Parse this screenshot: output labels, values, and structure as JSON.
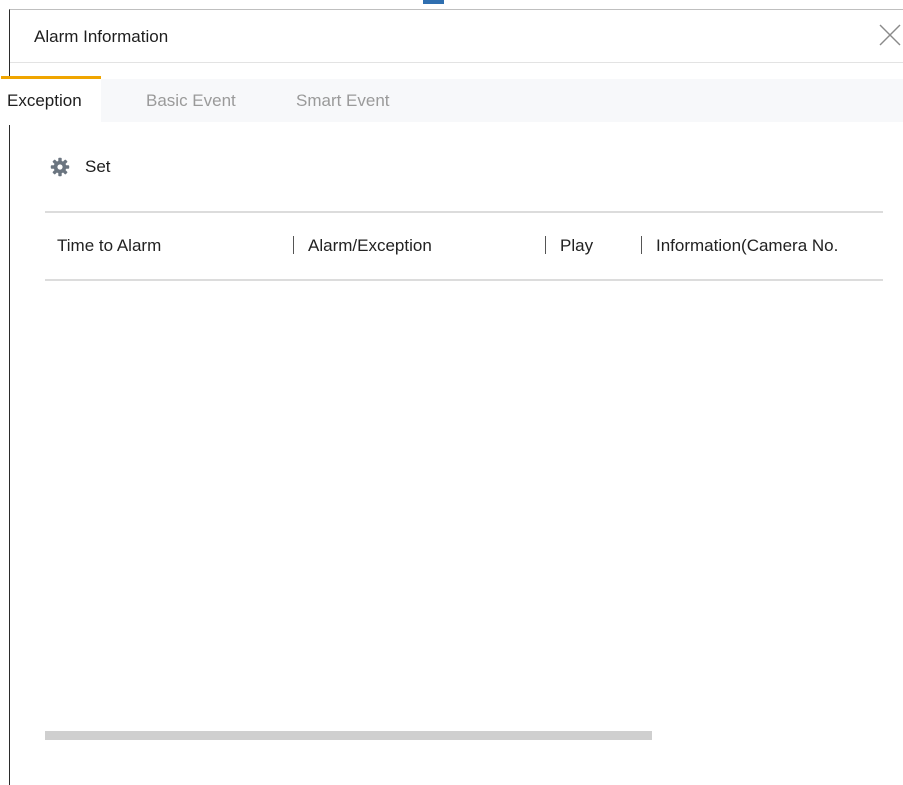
{
  "dialog": {
    "title": "Alarm Information",
    "close_icon": "close-icon"
  },
  "tabs": [
    {
      "label": "Exception",
      "active": true
    },
    {
      "label": "Basic Event",
      "active": false
    },
    {
      "label": "Smart Event",
      "active": false
    }
  ],
  "toolbar": {
    "set_icon": "gear-icon",
    "set_label": "Set"
  },
  "table": {
    "columns": [
      "Time to Alarm",
      "Alarm/Exception",
      "Play",
      "Information(Camera No."
    ],
    "rows": []
  },
  "colors": {
    "active_tab_accent": "#f0a500",
    "scrollbar": "#cfcfcf"
  }
}
